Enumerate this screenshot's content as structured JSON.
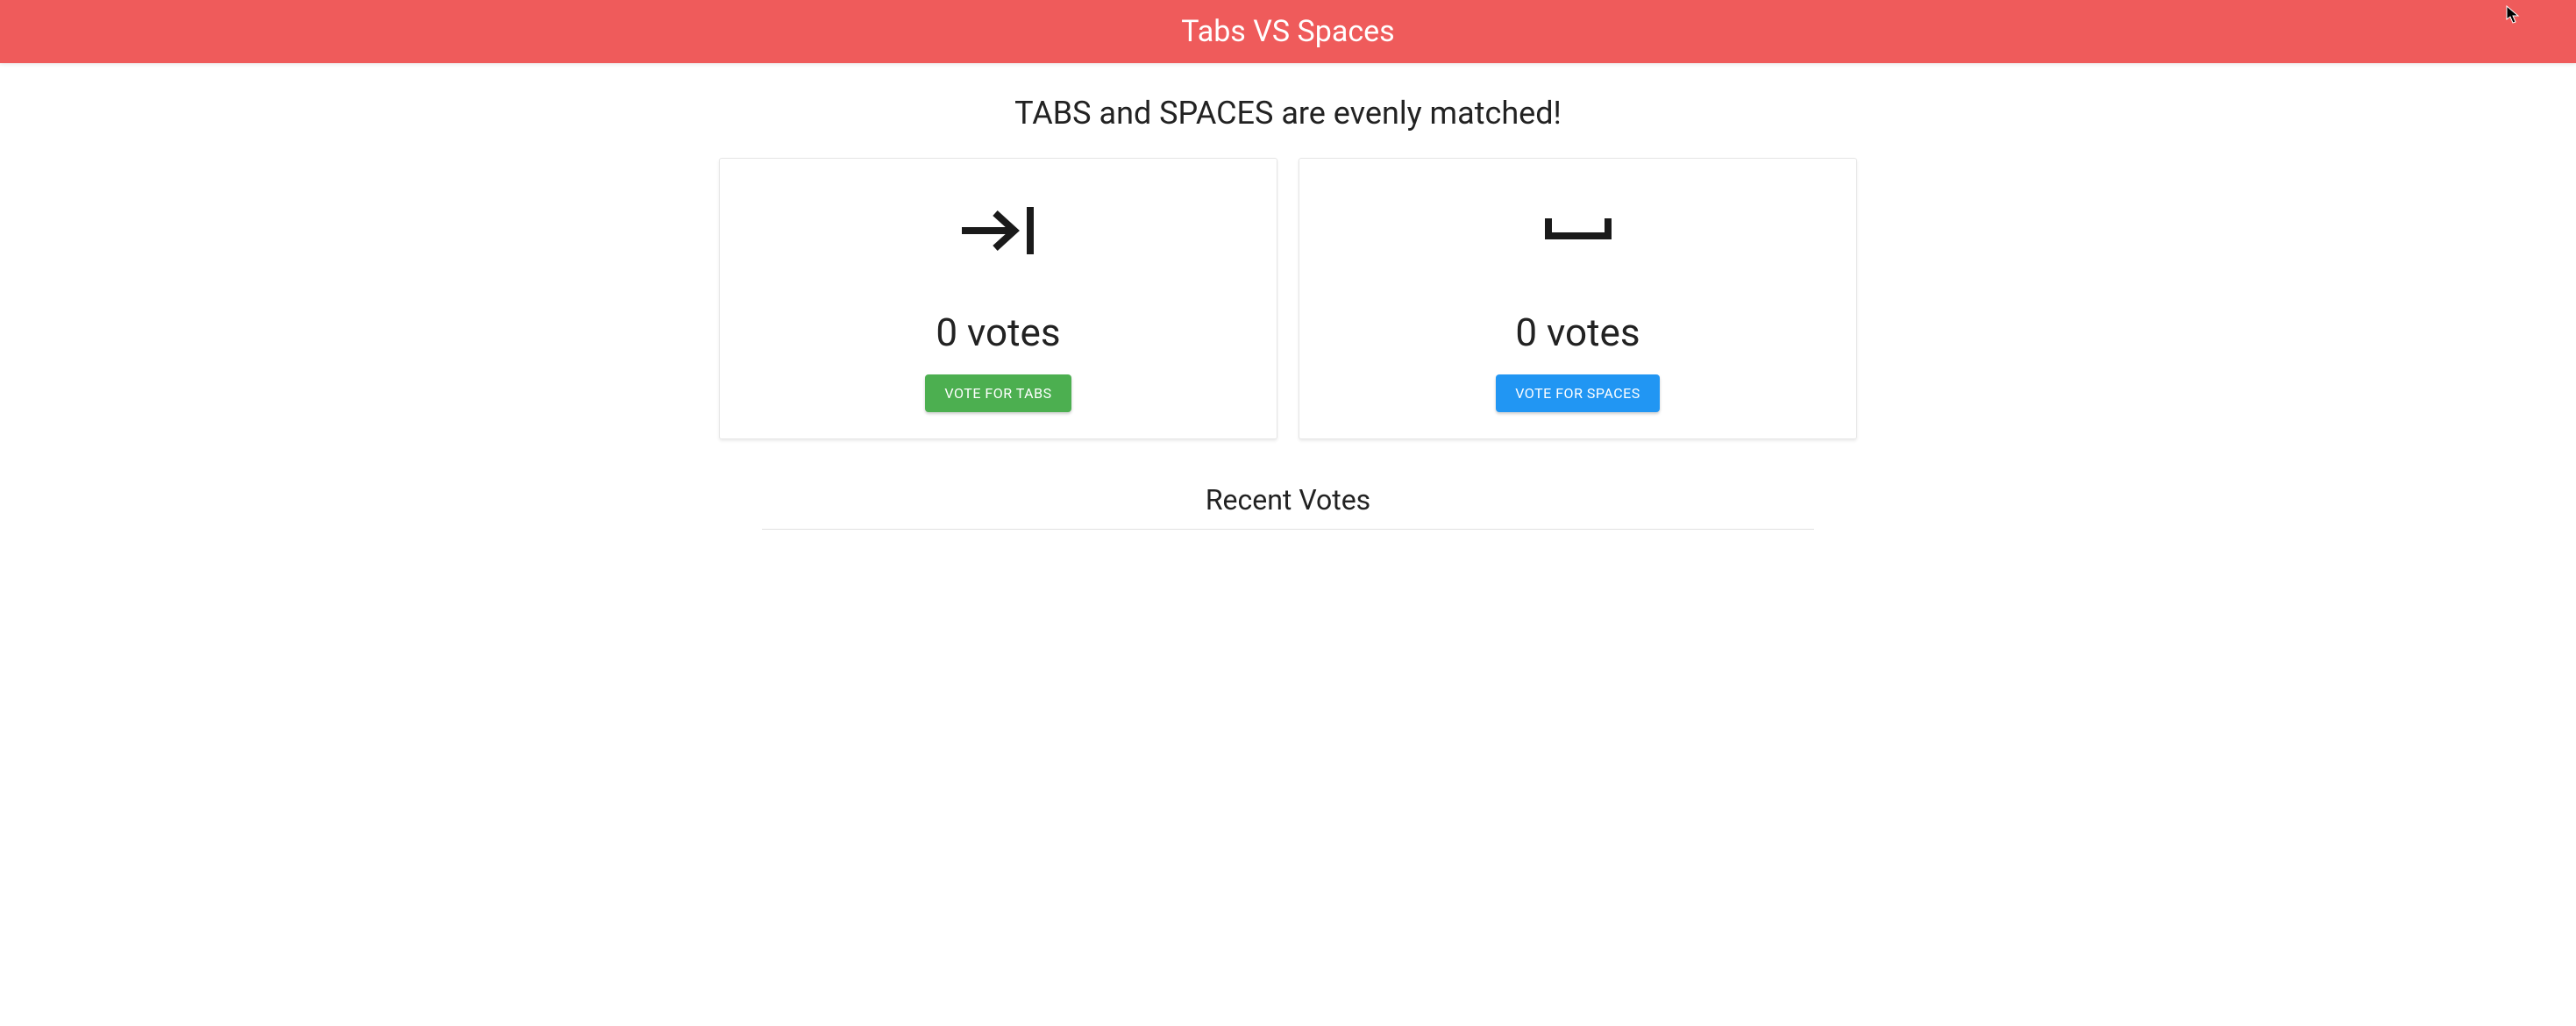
{
  "header": {
    "title": "Tabs VS Spaces"
  },
  "status": {
    "heading": "TABS and SPACES are evenly matched!"
  },
  "cards": {
    "tabs": {
      "icon_name": "tab-icon",
      "votes_text": "0 votes",
      "button_label": "VOTE FOR TABS",
      "button_color": "#4caf50"
    },
    "spaces": {
      "icon_name": "space-icon",
      "votes_text": "0 votes",
      "button_label": "VOTE FOR SPACES",
      "button_color": "#2196f3"
    }
  },
  "recent": {
    "heading": "Recent Votes"
  }
}
